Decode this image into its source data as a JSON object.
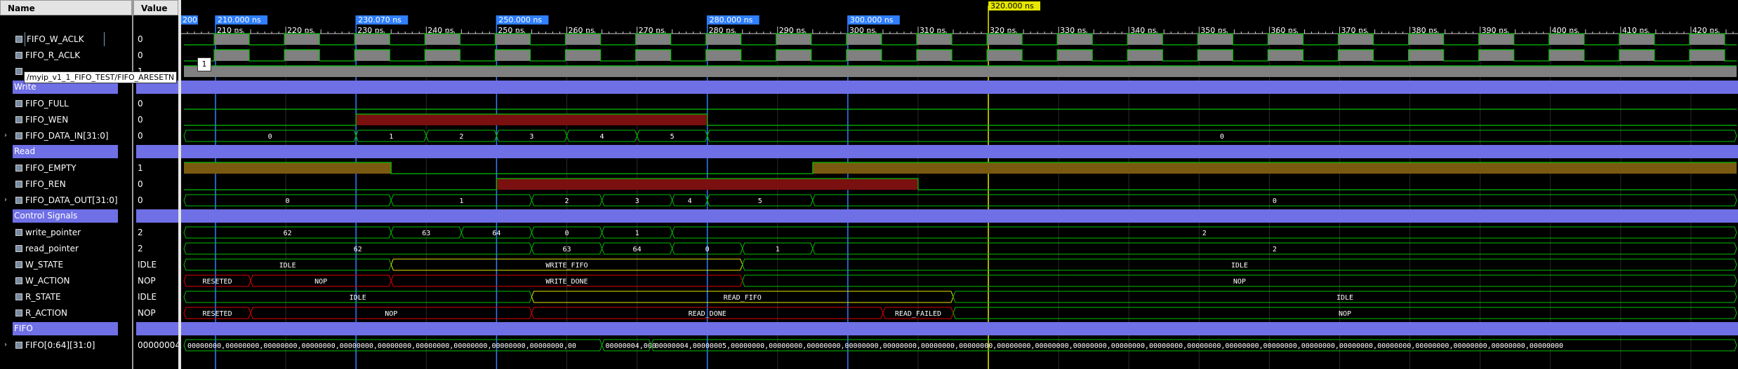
{
  "names_header": "Name",
  "values_header": "Value",
  "tooltip": "/myip_v1_1_FIFO_TEST/FIFO_ARESETN",
  "marker_badge": "1",
  "signals": [
    {
      "name": "FIFO_W_ACLK",
      "value": "0",
      "kind": "bit",
      "selected": true
    },
    {
      "name": "FIFO_R_ACLK",
      "value": "0",
      "kind": "bit"
    },
    {
      "name": "FIFO_ARESETN",
      "value": "1",
      "kind": "bit",
      "label_hidden": true
    },
    {
      "name": "Write",
      "kind": "group"
    },
    {
      "name": "FIFO_FULL",
      "value": "0",
      "kind": "bit"
    },
    {
      "name": "FIFO_WEN",
      "value": "0",
      "kind": "bit"
    },
    {
      "name": "FIFO_DATA_IN[31:0]",
      "value": "0",
      "kind": "bus",
      "expandable": true
    },
    {
      "name": "Read",
      "kind": "group"
    },
    {
      "name": "FIFO_EMPTY",
      "value": "1",
      "kind": "bit"
    },
    {
      "name": "FIFO_REN",
      "value": "0",
      "kind": "bit"
    },
    {
      "name": "FIFO_DATA_OUT[31:0]",
      "value": "0",
      "kind": "bus",
      "expandable": true
    },
    {
      "name": "Control Signals",
      "kind": "group"
    },
    {
      "name": "write_pointer",
      "value": "2",
      "kind": "bus"
    },
    {
      "name": "read_pointer",
      "value": "2",
      "kind": "bus"
    },
    {
      "name": "W_STATE",
      "value": "IDLE",
      "kind": "bus"
    },
    {
      "name": "W_ACTION",
      "value": "NOP",
      "kind": "bus"
    },
    {
      "name": "R_STATE",
      "value": "IDLE",
      "kind": "bus"
    },
    {
      "name": "R_ACTION",
      "value": "NOP",
      "kind": "bus"
    },
    {
      "name": "FIFO",
      "kind": "group"
    },
    {
      "name": "FIFO[0:64][31:0]",
      "value": "00000004",
      "kind": "bus",
      "expandable": true
    }
  ],
  "timeline": {
    "start_ns": 205.5,
    "end_ns": 426.5,
    "tick_labels": [
      "210 ns",
      "220 ns",
      "230 ns",
      "240 ns",
      "250 ns",
      "260 ns",
      "270 ns",
      "280 ns",
      "290 ns",
      "300 ns",
      "310 ns",
      "320 ns",
      "330 ns",
      "340 ns",
      "350 ns",
      "360 ns",
      "370 ns",
      "380 ns",
      "390 ns",
      "400 ns",
      "410 ns",
      "420 ns"
    ],
    "tick_values_ns": [
      210,
      220,
      230,
      240,
      250,
      260,
      270,
      280,
      290,
      300,
      310,
      320,
      330,
      340,
      350,
      360,
      370,
      380,
      390,
      400,
      410,
      420
    ],
    "markers": [
      {
        "ns": 210,
        "label": "210.000 ns"
      },
      {
        "ns": 230,
        "label": "230.070 ns"
      },
      {
        "ns": 250,
        "label": "250.000 ns"
      },
      {
        "ns": 280,
        "label": "280.000 ns"
      },
      {
        "ns": 300,
        "label": "300.000 ns"
      }
    ],
    "left_marker_label": "200",
    "cursor": {
      "ns": 320,
      "label": "320.000 ns"
    },
    "clock_period_ns": 10,
    "w_clk_rise_offset_ns": 4.8,
    "r_clk_rise_offset_ns": 9.8
  },
  "waves": {
    "FIFO_FULL": [
      {
        "from": 205.5,
        "to": 426.5,
        "level": 0
      }
    ],
    "FIFO_WEN": [
      {
        "from": 205.5,
        "to": 230,
        "level": 0
      },
      {
        "from": 230,
        "to": 280,
        "level": 1
      },
      {
        "from": 280,
        "to": 426.5,
        "level": 0
      }
    ],
    "FIFO_EMPTY": [
      {
        "from": 205.5,
        "to": 235,
        "level": 1
      },
      {
        "from": 235,
        "to": 295,
        "level": 0
      },
      {
        "from": 295,
        "to": 426.5,
        "level": 1
      }
    ],
    "FIFO_REN": [
      {
        "from": 205.5,
        "to": 250,
        "level": 0
      },
      {
        "from": 250,
        "to": 310,
        "level": 1
      },
      {
        "from": 310,
        "to": 426.5,
        "level": 0
      }
    ],
    "FIFO_ARESETN": [
      {
        "from": 205.5,
        "to": 426.5,
        "level": 1
      }
    ],
    "FIFO_DATA_IN[31:0]": [
      {
        "from": 205.5,
        "to": 230,
        "v": "0"
      },
      {
        "from": 230,
        "to": 240,
        "v": "1"
      },
      {
        "from": 240,
        "to": 250,
        "v": "2"
      },
      {
        "from": 250,
        "to": 260,
        "v": "3"
      },
      {
        "from": 260,
        "to": 270,
        "v": "4"
      },
      {
        "from": 270,
        "to": 280,
        "v": "5"
      },
      {
        "from": 280,
        "to": 426.5,
        "v": "0"
      }
    ],
    "FIFO_DATA_OUT[31:0]": [
      {
        "from": 205.5,
        "to": 235,
        "v": "0"
      },
      {
        "from": 235,
        "to": 255,
        "v": "1"
      },
      {
        "from": 255,
        "to": 265,
        "v": "2"
      },
      {
        "from": 265,
        "to": 275,
        "v": "3"
      },
      {
        "from": 275,
        "to": 280,
        "v": "4"
      },
      {
        "from": 280,
        "to": 295,
        "v": "5"
      },
      {
        "from": 295,
        "to": 426.5,
        "v": "0"
      }
    ],
    "write_pointer": [
      {
        "from": 205.5,
        "to": 235,
        "v": "62"
      },
      {
        "from": 235,
        "to": 245,
        "v": "63"
      },
      {
        "from": 245,
        "to": 255,
        "v": "64"
      },
      {
        "from": 255,
        "to": 265,
        "v": "0"
      },
      {
        "from": 265,
        "to": 275,
        "v": "1"
      },
      {
        "from": 275,
        "to": 426.5,
        "v": "2"
      }
    ],
    "read_pointer": [
      {
        "from": 205.5,
        "to": 255,
        "v": "62"
      },
      {
        "from": 255,
        "to": 265,
        "v": "63"
      },
      {
        "from": 265,
        "to": 275,
        "v": "64"
      },
      {
        "from": 275,
        "to": 285,
        "v": "0"
      },
      {
        "from": 285,
        "to": 295,
        "v": "1"
      },
      {
        "from": 295,
        "to": 426.5,
        "v": "2"
      }
    ],
    "W_STATE": [
      {
        "from": 205.5,
        "to": 235,
        "v": "IDLE"
      },
      {
        "from": 235,
        "to": 285,
        "v": "WRITE_FIFO",
        "color": "#e6e600"
      },
      {
        "from": 285,
        "to": 426.5,
        "v": "IDLE"
      }
    ],
    "W_ACTION": [
      {
        "from": 205.5,
        "to": 215,
        "v": "RESETED",
        "color": "#e00000"
      },
      {
        "from": 215,
        "to": 235,
        "v": "NOP",
        "color": "#e00000"
      },
      {
        "from": 235,
        "to": 285,
        "v": "WRITE_DONE",
        "color": "#e00000"
      },
      {
        "from": 285,
        "to": 426.5,
        "v": "NOP"
      }
    ],
    "R_STATE": [
      {
        "from": 205.5,
        "to": 255,
        "v": "IDLE"
      },
      {
        "from": 255,
        "to": 315,
        "v": "READ_FIFO",
        "color": "#e6e600"
      },
      {
        "from": 315,
        "to": 426.5,
        "v": "IDLE"
      }
    ],
    "R_ACTION": [
      {
        "from": 205.5,
        "to": 215,
        "v": "RESETED",
        "color": "#e00000"
      },
      {
        "from": 215,
        "to": 255,
        "v": "NOP",
        "color": "#e00000"
      },
      {
        "from": 255,
        "to": 305,
        "v": "READ_DONE",
        "color": "#e00000"
      },
      {
        "from": 305,
        "to": 315,
        "v": "READ_FAILED",
        "color": "#e00000"
      },
      {
        "from": 315,
        "to": 426.5,
        "v": "NOP"
      }
    ],
    "FIFO[0:64][31:0]": [
      {
        "from": 205.5,
        "to": 265,
        "v": "00000000,00000000,00000000,00000000,00000000,00000000,00000000,00000000,00000000,00000000,00"
      },
      {
        "from": 265,
        "to": 272,
        "v": "00000004,000"
      },
      {
        "from": 272,
        "to": 426.5,
        "v": "00000004,00000005,00000000,00000000,00000000,00000000,00000000,00000000,00000000,00000000,00000000,00000000,00000000,00000000,00000000,00000000,00000000,00000000,00000000,00000000,00000000,00000000,00000000,00000000"
      }
    ]
  },
  "colors": {
    "group": "#6f6fe6",
    "bit": "#00c000",
    "bus": "#00c000",
    "cursor": "#e6e600",
    "marker": "#2f7fff",
    "clock_fill": "#808080",
    "hi_fill_wen": "#7a1010",
    "hi_fill_empty": "#7a5a10"
  }
}
